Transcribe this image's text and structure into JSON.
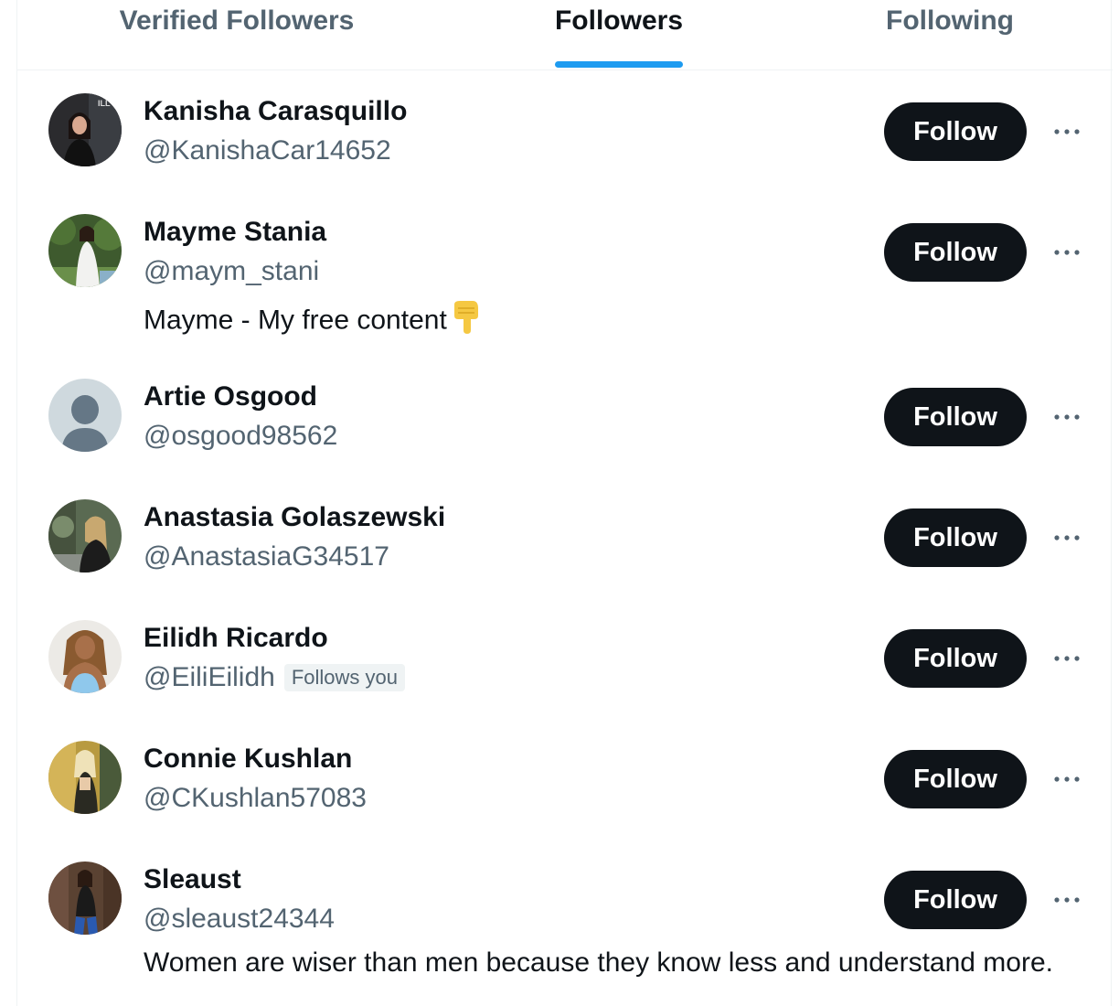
{
  "tabs": [
    {
      "label": "Verified Followers",
      "active": false
    },
    {
      "label": "Followers",
      "active": true
    },
    {
      "label": "Following",
      "active": false
    }
  ],
  "follow_label": "Follow",
  "users": [
    {
      "name": "Kanisha Carasquillo",
      "handle": "@KanishaCar14652",
      "bio": "",
      "follows_you": ""
    },
    {
      "name": "Mayme Stania",
      "handle": "@maym_stani",
      "bio": "Mayme - My free content",
      "follows_you": ""
    },
    {
      "name": "Artie Osgood",
      "handle": "@osgood98562",
      "bio": "",
      "follows_you": ""
    },
    {
      "name": "Anastasia Golaszewski",
      "handle": "@AnastasiaG34517",
      "bio": "",
      "follows_you": ""
    },
    {
      "name": "Eilidh Ricardo",
      "handle": "@EiliEilidh",
      "bio": "",
      "follows_you": "Follows you"
    },
    {
      "name": "Connie Kushlan",
      "handle": "@CKushlan57083",
      "bio": "",
      "follows_you": ""
    },
    {
      "name": "Sleaust",
      "handle": "@sleaust24344",
      "bio": "Women are wiser than men because they know less and understand more.",
      "follows_you": ""
    }
  ],
  "colors": {
    "accent": "#1d9bf0",
    "text_primary": "#0f1419",
    "text_secondary": "#536471",
    "button_bg": "#0f1419"
  },
  "icons": {
    "more": "more-horizontal-icon",
    "bio_emoji": "pointing-down-hand-icon",
    "default_avatar": "default-avatar-icon"
  }
}
